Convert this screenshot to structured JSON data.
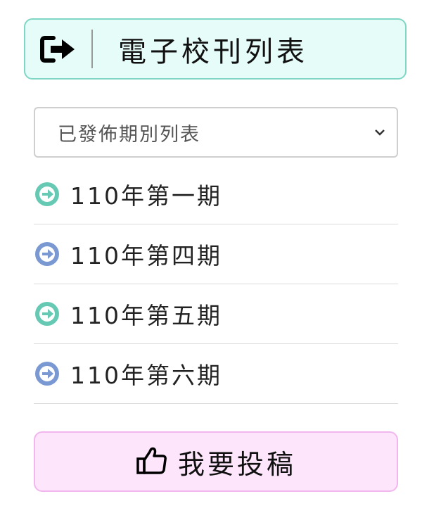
{
  "header": {
    "title": "電子校刊列表",
    "icon": "sign-out-icon"
  },
  "issue_select": {
    "selected": "已發佈期別列表"
  },
  "issues": [
    {
      "label": "110年第一期",
      "icon_color": "#66c9b3"
    },
    {
      "label": "110年第四期",
      "icon_color": "#7a98d2"
    },
    {
      "label": "110年第五期",
      "icon_color": "#66c9b3"
    },
    {
      "label": "110年第六期",
      "icon_color": "#7a98d2"
    }
  ],
  "submit_button": {
    "label": "我要投稿",
    "icon": "thumbs-up-icon"
  },
  "colors": {
    "header_bg": "#e6fcf8",
    "header_border": "#7fd6c4",
    "submit_bg": "#fde6fb",
    "submit_border": "#f2b6ee"
  }
}
